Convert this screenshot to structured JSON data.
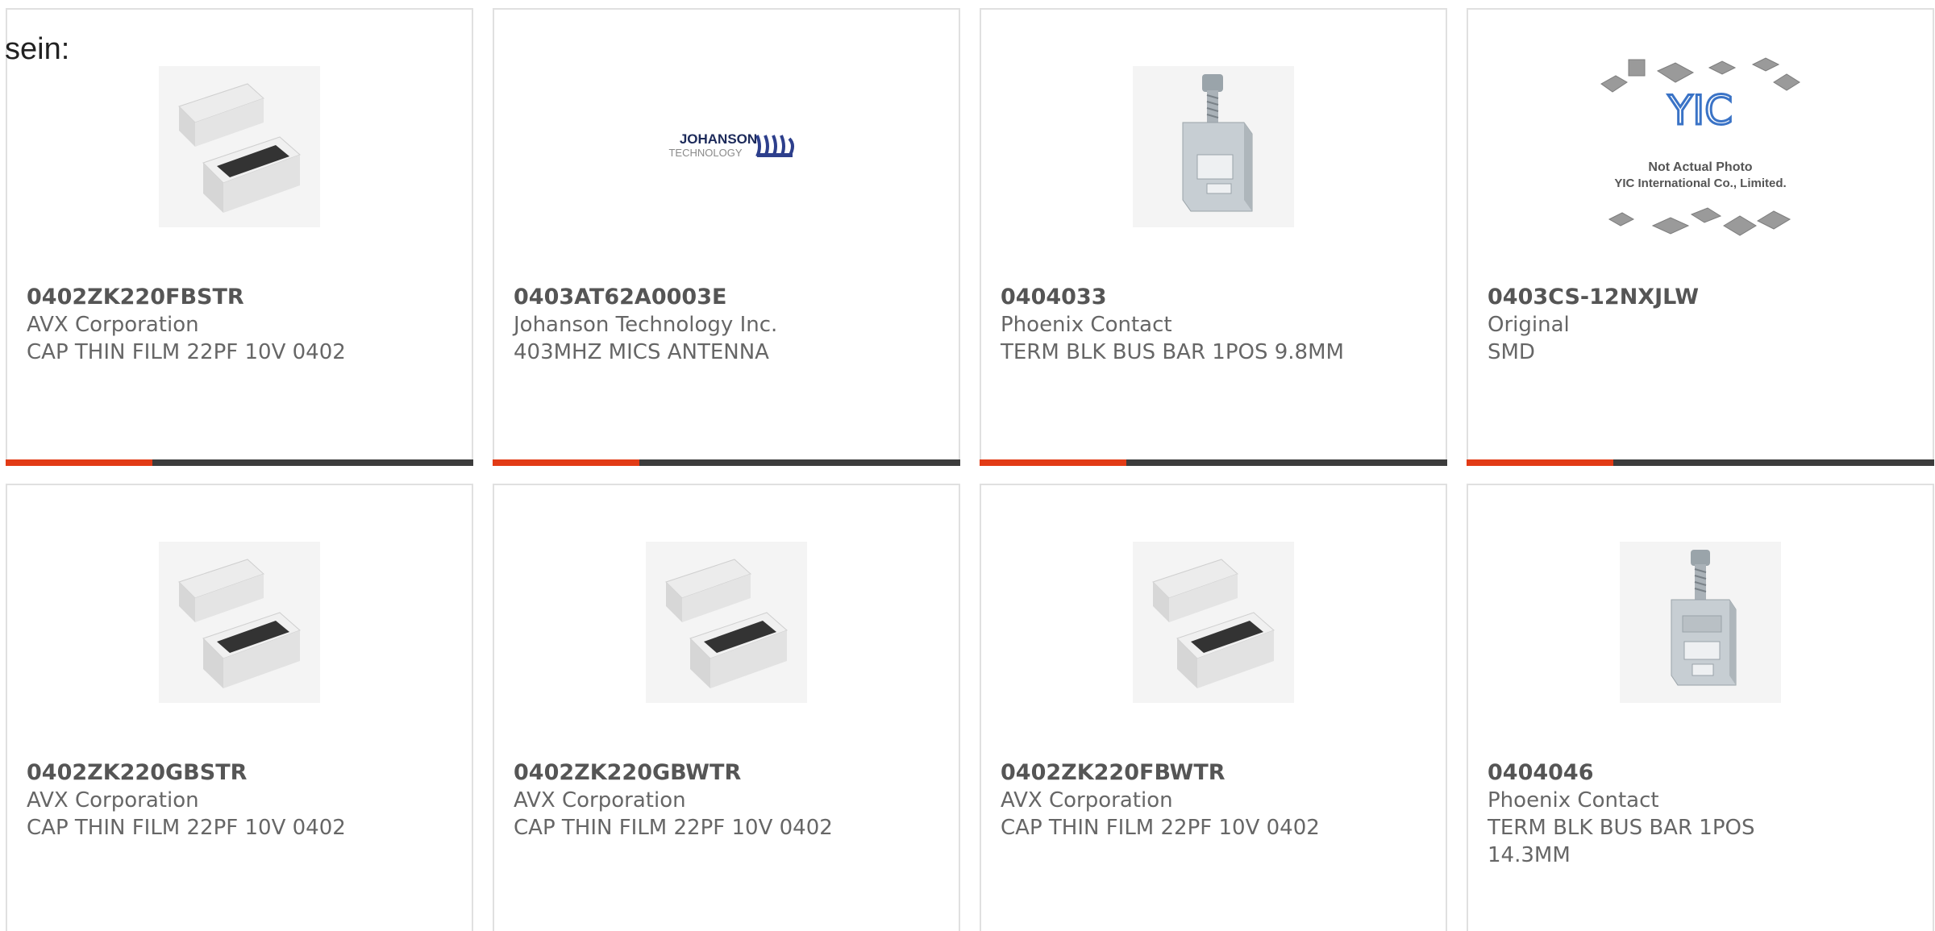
{
  "intro_text": "sein:",
  "colors": {
    "accent": "#e23b16",
    "bar_dark": "#3c3c3c",
    "card_border": "#e0e0e0",
    "text": "#666666"
  },
  "products": [
    {
      "part": "0402ZK220FBSTR",
      "manufacturer": "AVX Corporation",
      "description": "CAP THIN FILM 22PF 10V 0402",
      "image": "chip-capacitor-image"
    },
    {
      "part": "0403AT62A0003E",
      "manufacturer": "Johanson Technology Inc.",
      "description": "403MHZ MICS ANTENNA",
      "image": "johanson-logo-image",
      "logo_text_1": "JOHANSON",
      "logo_text_2": "TECHNOLOGY"
    },
    {
      "part": "0404033",
      "manufacturer": "Phoenix Contact",
      "description": "TERM BLK BUS BAR 1POS 9.8MM",
      "image": "bus-bar-terminal-image"
    },
    {
      "part": "0403CS-12NXJLW",
      "manufacturer": "Original",
      "description": "SMD",
      "image": "yic-placeholder-image",
      "logo_text": "YIC",
      "caption_1": "Not Actual Photo",
      "caption_2": "YIC International Co., Limited."
    },
    {
      "part": "0402ZK220GBSTR",
      "manufacturer": "AVX Corporation",
      "description": "CAP THIN FILM 22PF 10V 0402",
      "image": "chip-capacitor-image"
    },
    {
      "part": "0402ZK220GBWTR",
      "manufacturer": "AVX Corporation",
      "description": "CAP THIN FILM 22PF 10V 0402",
      "image": "chip-capacitor-image"
    },
    {
      "part": "0402ZK220FBWTR",
      "manufacturer": "AVX Corporation",
      "description": "CAP THIN FILM 22PF 10V 0402",
      "image": "chip-capacitor-image"
    },
    {
      "part": "0404046",
      "manufacturer": "Phoenix Contact",
      "description": "TERM BLK BUS BAR 1POS 14.3MM",
      "image": "bus-bar-terminal-image"
    }
  ]
}
